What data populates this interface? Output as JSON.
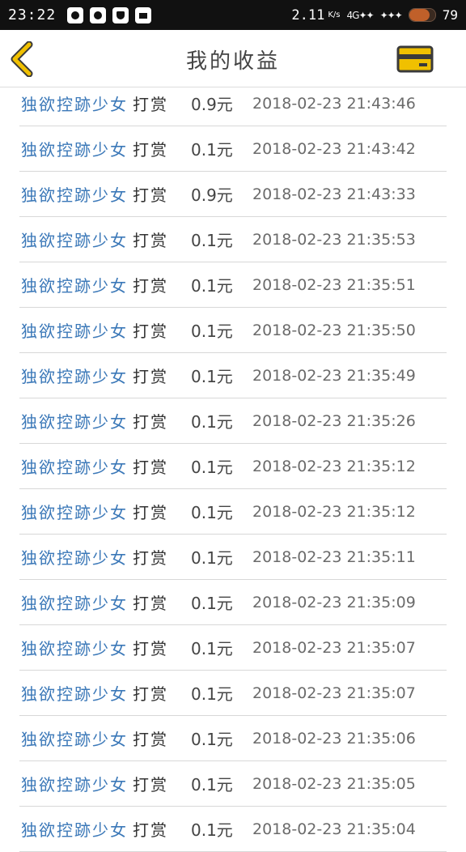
{
  "status_bar": {
    "time": "23:22",
    "net_speed": "2.11",
    "net_unit": "K/s",
    "network": "4G",
    "battery_level": "79",
    "battery_fraction": 0.79,
    "notification_icons": [
      "weibo-icon",
      "qq-icon",
      "shield-icon",
      "mail-icon"
    ]
  },
  "header": {
    "title": "我的收益",
    "back_icon": "chevron-left-icon",
    "card_icon": "bank-card-icon",
    "accent_color": "#f0c000"
  },
  "records": [
    {
      "user": "独欲控跡少女",
      "action": "打赏",
      "amount": "0.9元",
      "time": "2018-02-23 21:43:46"
    },
    {
      "user": "独欲控跡少女",
      "action": "打赏",
      "amount": "0.1元",
      "time": "2018-02-23 21:43:42"
    },
    {
      "user": "独欲控跡少女",
      "action": "打赏",
      "amount": "0.9元",
      "time": "2018-02-23 21:43:33"
    },
    {
      "user": "独欲控跡少女",
      "action": "打赏",
      "amount": "0.1元",
      "time": "2018-02-23 21:35:53"
    },
    {
      "user": "独欲控跡少女",
      "action": "打赏",
      "amount": "0.1元",
      "time": "2018-02-23 21:35:51"
    },
    {
      "user": "独欲控跡少女",
      "action": "打赏",
      "amount": "0.1元",
      "time": "2018-02-23 21:35:50"
    },
    {
      "user": "独欲控跡少女",
      "action": "打赏",
      "amount": "0.1元",
      "time": "2018-02-23 21:35:49"
    },
    {
      "user": "独欲控跡少女",
      "action": "打赏",
      "amount": "0.1元",
      "time": "2018-02-23 21:35:26"
    },
    {
      "user": "独欲控跡少女",
      "action": "打赏",
      "amount": "0.1元",
      "time": "2018-02-23 21:35:12"
    },
    {
      "user": "独欲控跡少女",
      "action": "打赏",
      "amount": "0.1元",
      "time": "2018-02-23 21:35:12"
    },
    {
      "user": "独欲控跡少女",
      "action": "打赏",
      "amount": "0.1元",
      "time": "2018-02-23 21:35:11"
    },
    {
      "user": "独欲控跡少女",
      "action": "打赏",
      "amount": "0.1元",
      "time": "2018-02-23 21:35:09"
    },
    {
      "user": "独欲控跡少女",
      "action": "打赏",
      "amount": "0.1元",
      "time": "2018-02-23 21:35:07"
    },
    {
      "user": "独欲控跡少女",
      "action": "打赏",
      "amount": "0.1元",
      "time": "2018-02-23 21:35:07"
    },
    {
      "user": "独欲控跡少女",
      "action": "打赏",
      "amount": "0.1元",
      "time": "2018-02-23 21:35:06"
    },
    {
      "user": "独欲控跡少女",
      "action": "打赏",
      "amount": "0.1元",
      "time": "2018-02-23 21:35:05"
    },
    {
      "user": "独欲控跡少女",
      "action": "打赏",
      "amount": "0.1元",
      "time": "2018-02-23 21:35:04"
    }
  ]
}
